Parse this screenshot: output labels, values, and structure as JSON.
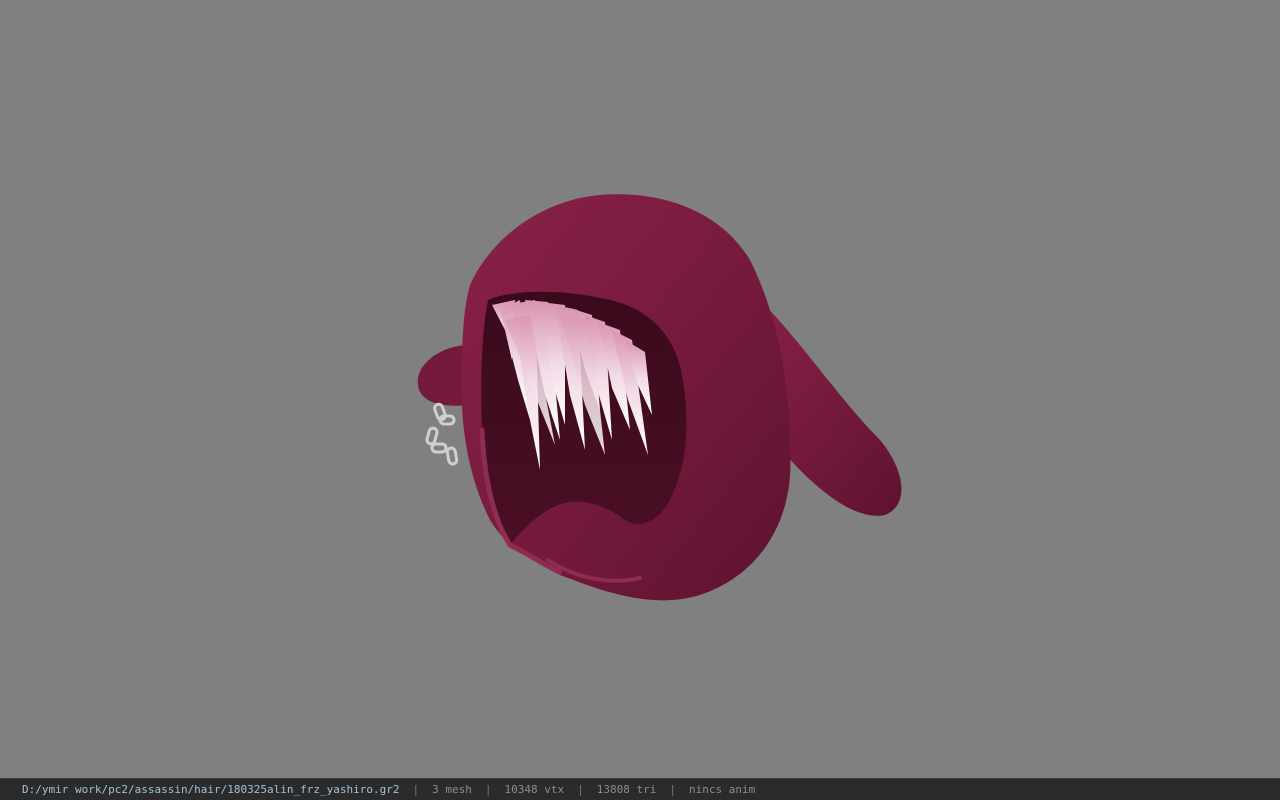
{
  "viewer": {
    "background_color": "#808080",
    "model": {
      "hood_color": "#7a1a3e",
      "hair_color": "#f0d6e2",
      "chain_color": "#c9c9c9"
    }
  },
  "statusbar": {
    "file_path": "D:/ymir work/pc2/assassin/hair/180325alin_frz_yashiro.gr2",
    "mesh": "3 mesh",
    "vtx": "10348 vtx",
    "tri": "13808 tri",
    "anim": "nincs anim"
  }
}
